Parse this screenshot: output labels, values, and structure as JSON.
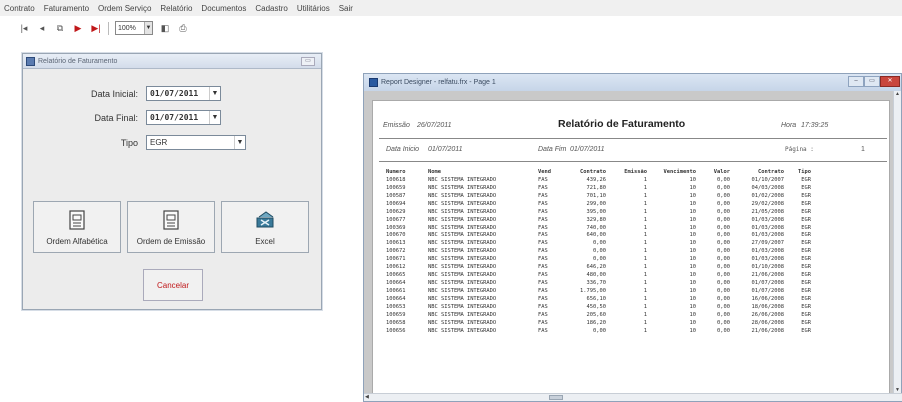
{
  "menu": [
    "Contrato",
    "Faturamento",
    "Ordem Serviço",
    "Relatório",
    "Documentos",
    "Cadastro",
    "Utilitários",
    "Sair"
  ],
  "toolbar": {
    "zoom": "100%"
  },
  "dialog": {
    "title": "Relatório de Faturamento",
    "data_inicial_label": "Data Inicial:",
    "data_inicial_value": "01/07/2011",
    "data_final_label": "Data Final:",
    "data_final_value": "01/07/2011",
    "tipo_label": "Tipo",
    "tipo_value": "EGR",
    "buttons": {
      "alfabetica": "Ordem Alfabética",
      "emissao": "Ordem de Emissão",
      "excel": "Excel",
      "cancelar": "Cancelar"
    }
  },
  "report_window": {
    "title": "Report Designer - relfatu.frx - Page 1",
    "emissao_label": "Emissão",
    "emissao_value": "26/07/2011",
    "report_title": "Relatório de Faturamento",
    "hora_label": "Hora",
    "hora_value": "17:39:25",
    "data_inicio_label": "Data Inicio",
    "data_inicio_value": "01/07/2011",
    "data_fim_label": "Data Fim",
    "data_fim_value": "01/07/2011",
    "pagina_label": "Página :",
    "pagina_value": "1",
    "columns": [
      "Numero",
      "Nome",
      "Vend",
      "Contrato",
      "Emissão",
      "Vencimento",
      "Valor",
      "Contrato",
      "Tipo"
    ],
    "rows": [
      [
        "100618",
        "NBC SISTEMA INTEGRADO",
        "FAS",
        "439,26",
        "1",
        "10",
        "0,00",
        "01/10/2007",
        "EGR"
      ],
      [
        "100659",
        "NBC SISTEMA INTEGRADO",
        "FAS",
        "721,80",
        "1",
        "10",
        "0,00",
        "04/03/2008",
        "EGR"
      ],
      [
        "100587",
        "NBC SISTEMA INTEGRADO",
        "FAS",
        "701,10",
        "1",
        "10",
        "0,00",
        "01/02/2008",
        "EGR"
      ],
      [
        "100694",
        "NBC SISTEMA INTEGRADO",
        "FAS",
        "299,00",
        "1",
        "10",
        "0,00",
        "29/02/2008",
        "EGR"
      ],
      [
        "100629",
        "NBC SISTEMA INTEGRADO",
        "FAS",
        "395,00",
        "1",
        "10",
        "0,00",
        "21/05/2008",
        "EGR"
      ],
      [
        "100677",
        "NBC SISTEMA INTEGRADO",
        "FAS",
        "329,80",
        "1",
        "10",
        "0,00",
        "01/03/2008",
        "EGR"
      ],
      [
        "100369",
        "NBC SISTEMA INTEGRADO",
        "FAS",
        "740,00",
        "1",
        "10",
        "0,00",
        "01/03/2008",
        "EGR"
      ],
      [
        "100670",
        "NBC SISTEMA INTEGRADO",
        "FAS",
        "640,00",
        "1",
        "10",
        "0,00",
        "01/03/2008",
        "EGR"
      ],
      [
        "100613",
        "NBC SISTEMA INTEGRADO",
        "FAS",
        "0,00",
        "1",
        "10",
        "0,00",
        "27/09/2007",
        "EGR"
      ],
      [
        "100672",
        "NBC SISTEMA INTEGRADO",
        "FAS",
        "0,00",
        "1",
        "10",
        "0,00",
        "01/03/2008",
        "EGR"
      ],
      [
        "100671",
        "NBC SISTEMA INTEGRADO",
        "FAS",
        "0,00",
        "1",
        "10",
        "0,00",
        "01/03/2008",
        "EGR"
      ],
      [
        "100612",
        "NBC SISTEMA INTEGRADO",
        "FAS",
        "646,20",
        "1",
        "10",
        "0,00",
        "01/10/2008",
        "EGR"
      ],
      [
        "100665",
        "NBC SISTEMA INTEGRADO",
        "FAS",
        "480,00",
        "1",
        "10",
        "0,00",
        "21/06/2008",
        "EGR"
      ],
      [
        "100664",
        "NBC SISTEMA INTEGRADO",
        "FAS",
        "336,70",
        "1",
        "10",
        "0,00",
        "01/07/2008",
        "EGR"
      ],
      [
        "100661",
        "NBC SISTEMA INTEGRADO",
        "FAS",
        "1.795,00",
        "1",
        "10",
        "0,00",
        "01/07/2008",
        "EGR"
      ],
      [
        "100664",
        "NBC SISTEMA INTEGRADO",
        "FAS",
        "656,10",
        "1",
        "10",
        "0,00",
        "16/06/2008",
        "EGR"
      ],
      [
        "100653",
        "NBC SISTEMA INTEGRADO",
        "FAS",
        "450,50",
        "1",
        "10",
        "0,00",
        "18/06/2008",
        "EGR"
      ],
      [
        "100659",
        "NBC SISTEMA INTEGRADO",
        "FAS",
        "205,60",
        "1",
        "10",
        "0,00",
        "26/06/2008",
        "EGR"
      ],
      [
        "100658",
        "NBC SISTEMA INTEGRADO",
        "FAS",
        "186,20",
        "1",
        "10",
        "0,00",
        "28/06/2008",
        "EGR"
      ],
      [
        "100656",
        "NBC SISTEMA INTEGRADO",
        "FAS",
        "0,00",
        "1",
        "10",
        "0,00",
        "21/06/2008",
        "EGR"
      ]
    ]
  }
}
